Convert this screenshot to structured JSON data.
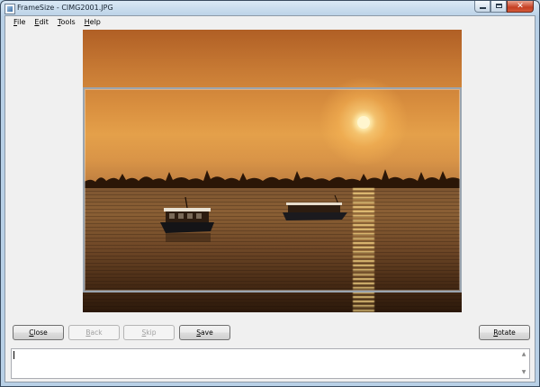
{
  "window": {
    "title": "FrameSize - CIMG2001.JPG",
    "close_glyph": "✕"
  },
  "menu": [
    {
      "label": "File",
      "access": "F"
    },
    {
      "label": "Edit",
      "access": "E"
    },
    {
      "label": "Tools",
      "access": "T"
    },
    {
      "label": "Help",
      "access": "H"
    }
  ],
  "buttons": {
    "close": {
      "label": "Close",
      "enabled": true
    },
    "back": {
      "label": "Back",
      "enabled": false
    },
    "skip": {
      "label": "Skip",
      "enabled": false
    },
    "save": {
      "label": "Save",
      "enabled": true
    },
    "rotate": {
      "label": "Rotate",
      "enabled": true
    }
  },
  "status": {
    "text": "",
    "up_arrow": "▲",
    "down_arrow": "▼"
  },
  "icons": [
    "app-icon",
    "minimize-icon",
    "maximize-icon",
    "close-icon",
    "scroll-up-icon",
    "scroll-down-icon"
  ]
}
